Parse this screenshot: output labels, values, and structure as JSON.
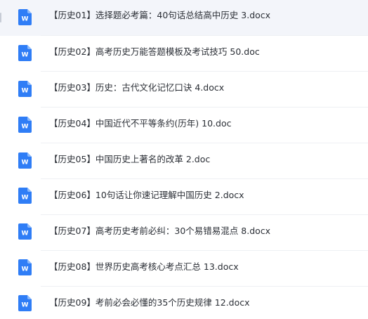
{
  "file_icon": {
    "name": "word-document-icon",
    "color": "#2f7df6",
    "glyph": "W"
  },
  "files": [
    {
      "name": "【历史01】选择题必考篇：40句话总结高中历史 3.docx",
      "highlighted": true
    },
    {
      "name": "【历史02】高考历史万能答题模板及考试技巧 50.doc",
      "highlighted": false
    },
    {
      "name": "【历史03】历史：古代文化记忆口诀 4.docx",
      "highlighted": false
    },
    {
      "name": "【历史04】中国近代不平等条约(历年) 10.doc",
      "highlighted": false
    },
    {
      "name": "【历史05】中国历史上著名的改革 2.doc",
      "highlighted": false
    },
    {
      "name": "【历史06】10句话让你速记理解中国历史 2.docx",
      "highlighted": false
    },
    {
      "name": "【历史07】高考历史考前必纠：30个易错易混点 8.docx",
      "highlighted": false
    },
    {
      "name": "【历史08】世界历史高考核心考点汇总 13.docx",
      "highlighted": false
    },
    {
      "name": "【历史09】考前必会必懂的35个历史规律 12.docx",
      "highlighted": false
    }
  ]
}
